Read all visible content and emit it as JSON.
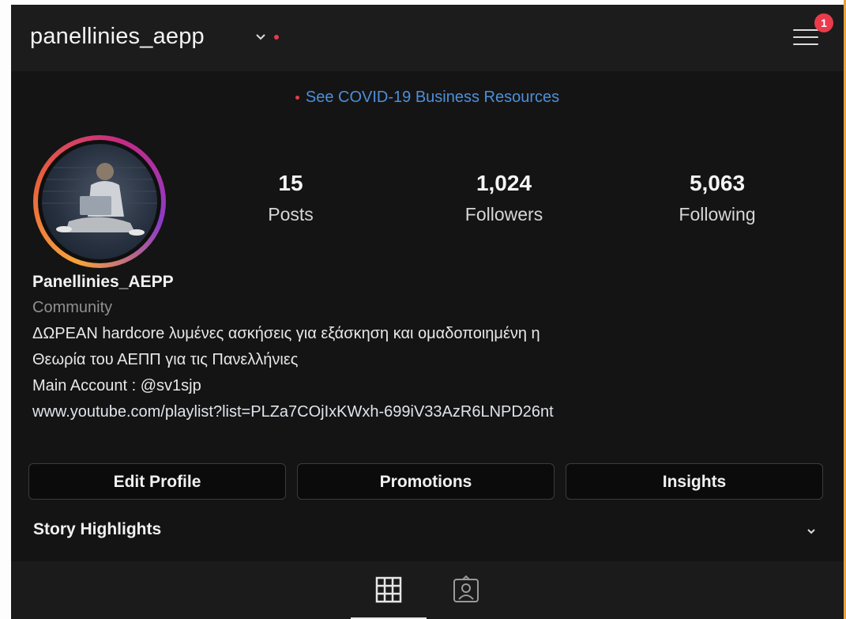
{
  "header": {
    "username": "panellinies_aepp",
    "notification_count": "1"
  },
  "promo": {
    "text": "See COVID-19 Business Resources"
  },
  "stats": [
    {
      "value": "15",
      "label": "Posts"
    },
    {
      "value": "1,024",
      "label": "Followers"
    },
    {
      "value": "5,063",
      "label": "Following"
    }
  ],
  "bio": {
    "name": "Panellinies_AEPP",
    "category": "Community",
    "line1": "ΔΩΡΕΑΝ  hardcore λυμένες ασκήσεις για εξάσκηση και ομαδοποιημένη η",
    "line2": "Θεωρία του ΑΕΠΠ για τις Πανελλήνιες",
    "main_account": "Main Account : @sv1sjp",
    "link": "www.youtube.com/playlist?list=PLZa7COjIxKWxh-699iV33AzR6LNPD26nt"
  },
  "buttons": {
    "edit_profile": "Edit Profile",
    "promotions": "Promotions",
    "insights": "Insights"
  },
  "highlights": {
    "label": "Story Highlights"
  },
  "colors": {
    "background": "#141414",
    "accent_link": "#4d8fd9",
    "badge": "#ea3b4c",
    "frame_edge": "#e9a23b"
  },
  "icons": [
    "chevron-down-icon",
    "hamburger-menu-icon",
    "grid-icon",
    "tagged-person-icon"
  ]
}
